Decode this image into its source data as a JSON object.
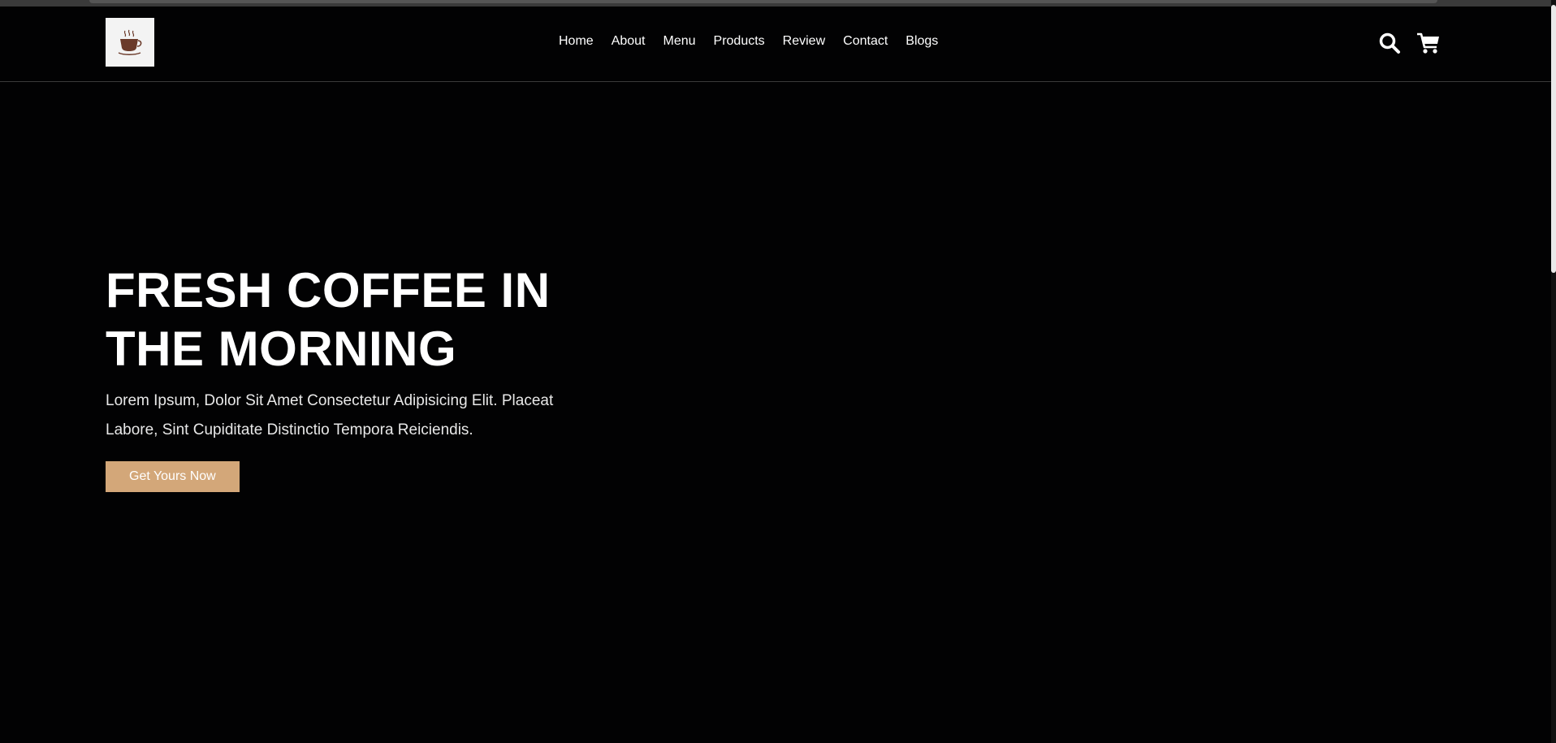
{
  "header": {
    "logo_alt": "coffee cup logo",
    "nav": [
      {
        "label": "Home"
      },
      {
        "label": "About"
      },
      {
        "label": "Menu"
      },
      {
        "label": "Products"
      },
      {
        "label": "Review"
      },
      {
        "label": "Contact"
      },
      {
        "label": "Blogs"
      }
    ],
    "icons": [
      "search-icon",
      "cart-icon"
    ]
  },
  "hero": {
    "title_line1": "FRESH COFFEE IN",
    "title_line2": "THE MORNING",
    "description_line1": "Lorem Ipsum, Dolor Sit Amet Consectetur Adipisicing Elit. Placeat",
    "description_line2": "Labore, Sint Cupiditate Distinctio Tempora Reiciendis.",
    "cta_label": "Get Yours Now"
  },
  "colors": {
    "background": "#020203",
    "accent": "#d3a779",
    "text": "#ffffff"
  }
}
